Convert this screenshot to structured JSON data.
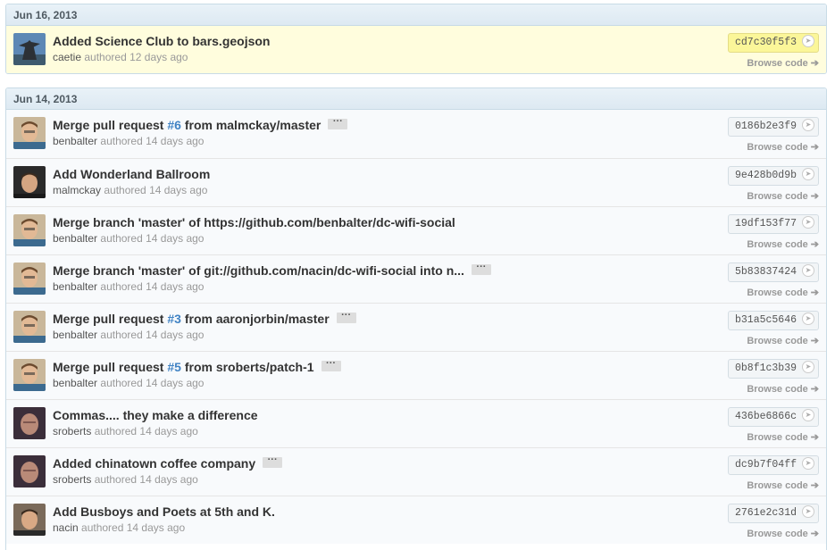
{
  "groups": [
    {
      "date": "Jun 16, 2013",
      "commits": [
        {
          "title_parts": [
            "Added Science Club to bars.geojson"
          ],
          "author": "caetie",
          "meta": "authored 12 days ago",
          "sha": "cd7c30f5f3",
          "browse": "Browse code",
          "avatar_icon": "statue-avatar"
        }
      ]
    },
    {
      "date": "Jun 14, 2013",
      "commits": [
        {
          "title_parts": [
            "Merge pull request ",
            "#6",
            " from malmckay/master"
          ],
          "ellipsis": "···",
          "author": "benbalter",
          "meta": "authored 14 days ago",
          "sha": "0186b2e3f9",
          "browse": "Browse code"
        },
        {
          "title_parts": [
            "Add Wonderland Ballroom"
          ],
          "author": "malmckay",
          "meta": "authored 14 days ago",
          "sha": "9e428b0d9b",
          "browse": "Browse code"
        },
        {
          "title_parts": [
            "Merge branch 'master' of https://github.com/benbalter/dc-wifi-social"
          ],
          "author": "benbalter",
          "meta": "authored 14 days ago",
          "sha": "19df153f77",
          "browse": "Browse code"
        },
        {
          "title_parts": [
            "Merge branch 'master' of git://github.com/nacin/dc-wifi-social into n..."
          ],
          "ellipsis": "···",
          "author": "benbalter",
          "meta": "authored 14 days ago",
          "sha": "5b83837424",
          "browse": "Browse code"
        },
        {
          "title_parts": [
            "Merge pull request ",
            "#3",
            " from aaronjorbin/master"
          ],
          "ellipsis": "···",
          "author": "benbalter",
          "meta": "authored 14 days ago",
          "sha": "b31a5c5646",
          "browse": "Browse code"
        },
        {
          "title_parts": [
            "Merge pull request ",
            "#5",
            " from sroberts/patch-1"
          ],
          "ellipsis": "···",
          "author": "benbalter",
          "meta": "authored 14 days ago",
          "sha": "0b8f1c3b39",
          "browse": "Browse code"
        },
        {
          "title_parts": [
            "Commas.... they make a difference"
          ],
          "author": "sroberts",
          "meta": "authored 14 days ago",
          "sha": "436be6866c",
          "browse": "Browse code"
        },
        {
          "title_parts": [
            "Added chinatown coffee company"
          ],
          "ellipsis": "···",
          "author": "sroberts",
          "meta": "authored 14 days ago",
          "sha": "dc9b7f04ff",
          "browse": "Browse code"
        },
        {
          "title_parts": [
            "Add Busboys and Poets at 5th and K."
          ],
          "author": "nacin",
          "meta": "authored 14 days ago",
          "sha": "2761e2c31d",
          "browse": "Browse code"
        }
      ]
    }
  ],
  "colors": {
    "link": "#4183c4",
    "highlight": "#fffddd",
    "header_bg": "#e5eff6"
  }
}
